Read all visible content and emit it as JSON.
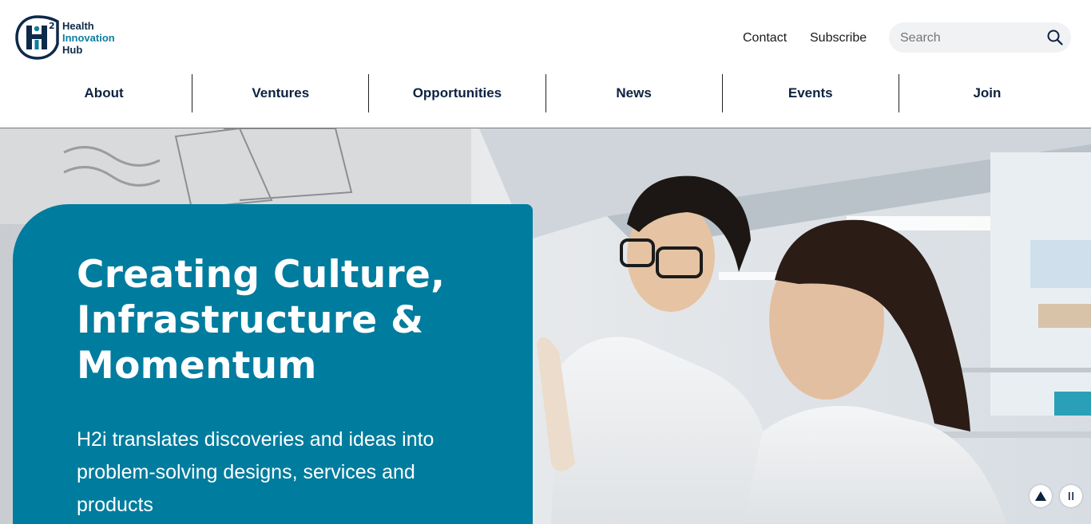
{
  "logo": {
    "line1": "Health",
    "line2": "Innovation",
    "line3": "Hub",
    "mark_text": "H",
    "mark_sup": "2"
  },
  "header": {
    "contact_label": "Contact",
    "subscribe_label": "Subscribe"
  },
  "search": {
    "placeholder": "Search",
    "icon": "search-icon"
  },
  "nav": {
    "items": [
      "About",
      "Ventures",
      "Opportunities",
      "News",
      "Events",
      "Join"
    ]
  },
  "hero": {
    "title": "Creating Culture, Infrastructure & Momentum",
    "subtitle": "H2i translates discoveries and ideas into problem-solving designs, services and products",
    "controls": {
      "up_icon": "triangle-up-icon",
      "pause_icon": "pause-icon"
    }
  },
  "colors": {
    "brand_teal": "#007c9e",
    "navy": "#0d2240",
    "search_bg": "#f1f2f4"
  }
}
